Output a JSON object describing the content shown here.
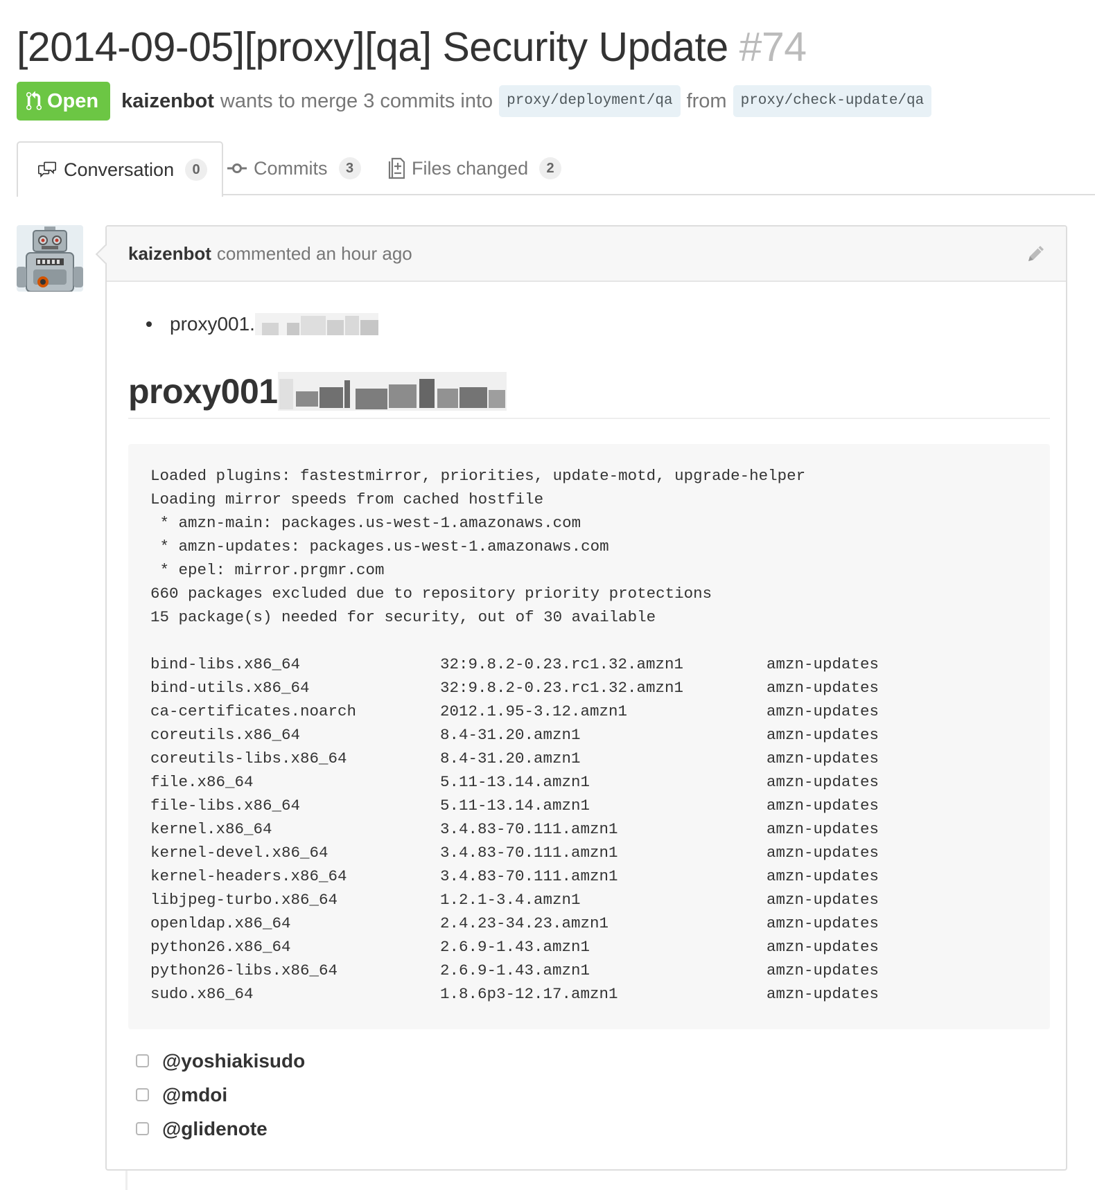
{
  "pr": {
    "title": "[2014-09-05][proxy][qa] Security Update",
    "number": "#74",
    "state": "Open",
    "author": "kaizenbot",
    "merge_text": "wants to merge 3 commits into",
    "base_branch": "proxy/deployment/qa",
    "from_text": "from",
    "head_branch": "proxy/check-update/qa"
  },
  "tabs": [
    {
      "label": "Conversation",
      "count": "0",
      "icon": "conversation-icon"
    },
    {
      "label": "Commits",
      "count": "3",
      "icon": "commit-icon"
    },
    {
      "label": "Files changed",
      "count": "2",
      "icon": "file-diff-icon"
    }
  ],
  "comment": {
    "author": "kaizenbot",
    "action": "commented an hour ago",
    "bullet_prefix": "proxy001.",
    "hostname_prefix": "proxy001",
    "pre_header": [
      "Loaded plugins: fastestmirror, priorities, update-motd, upgrade-helper",
      "Loading mirror speeds from cached hostfile",
      " * amzn-main: packages.us-west-1.amazonaws.com",
      " * amzn-updates: packages.us-west-1.amazonaws.com",
      " * epel: mirror.prgmr.com",
      "660 packages excluded due to repository priority protections",
      "15 package(s) needed for security, out of 30 available"
    ],
    "packages": [
      [
        "bind-libs.x86_64",
        "32:9.8.2-0.23.rc1.32.amzn1",
        "amzn-updates"
      ],
      [
        "bind-utils.x86_64",
        "32:9.8.2-0.23.rc1.32.amzn1",
        "amzn-updates"
      ],
      [
        "ca-certificates.noarch",
        "2012.1.95-3.12.amzn1",
        "amzn-updates"
      ],
      [
        "coreutils.x86_64",
        "8.4-31.20.amzn1",
        "amzn-updates"
      ],
      [
        "coreutils-libs.x86_64",
        "8.4-31.20.amzn1",
        "amzn-updates"
      ],
      [
        "file.x86_64",
        "5.11-13.14.amzn1",
        "amzn-updates"
      ],
      [
        "file-libs.x86_64",
        "5.11-13.14.amzn1",
        "amzn-updates"
      ],
      [
        "kernel.x86_64",
        "3.4.83-70.111.amzn1",
        "amzn-updates"
      ],
      [
        "kernel-devel.x86_64",
        "3.4.83-70.111.amzn1",
        "amzn-updates"
      ],
      [
        "kernel-headers.x86_64",
        "3.4.83-70.111.amzn1",
        "amzn-updates"
      ],
      [
        "libjpeg-turbo.x86_64",
        "1.2.1-3.4.amzn1",
        "amzn-updates"
      ],
      [
        "openldap.x86_64",
        "2.4.23-34.23.amzn1",
        "amzn-updates"
      ],
      [
        "python26.x86_64",
        "2.6.9-1.43.amzn1",
        "amzn-updates"
      ],
      [
        "python26-libs.x86_64",
        "2.6.9-1.43.amzn1",
        "amzn-updates"
      ],
      [
        "sudo.x86_64",
        "1.8.6p3-12.17.amzn1",
        "amzn-updates"
      ]
    ],
    "tasks": [
      "@yoshiakisudo",
      "@mdoi",
      "@glidenote"
    ]
  },
  "colors": {
    "open_state": "#6cc644",
    "branch_bg": "#e8f1f6",
    "border": "#dddddd",
    "pre_bg": "#f7f7f7"
  }
}
